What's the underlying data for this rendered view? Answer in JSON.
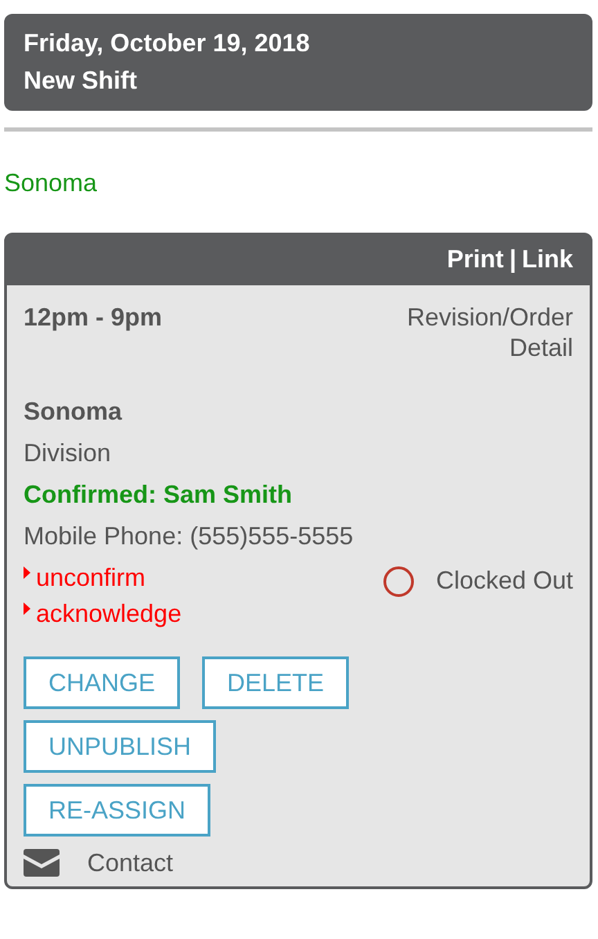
{
  "header": {
    "date": "Friday, October 19, 2018",
    "title": "New Shift"
  },
  "location": "Sonoma",
  "shift_card": {
    "header_links": [
      "Print",
      "Link"
    ],
    "header_separator": "|",
    "time": "12pm - 9pm",
    "detail_link": "Revision/Order Detail",
    "site": "Sonoma",
    "division": "Division",
    "confirmed": "Confirmed: Sam Smith",
    "phone": "Mobile Phone: (555)555-5555",
    "actions": [
      {
        "label": "unconfirm"
      },
      {
        "label": "acknowledge"
      }
    ],
    "clock_status": {
      "label": "Clocked Out",
      "clocked_in": false
    },
    "button_rows": [
      [
        "CHANGE",
        "DELETE"
      ],
      [
        "UNPUBLISH"
      ],
      [
        "RE-ASSIGN"
      ]
    ],
    "contact": "Contact"
  }
}
